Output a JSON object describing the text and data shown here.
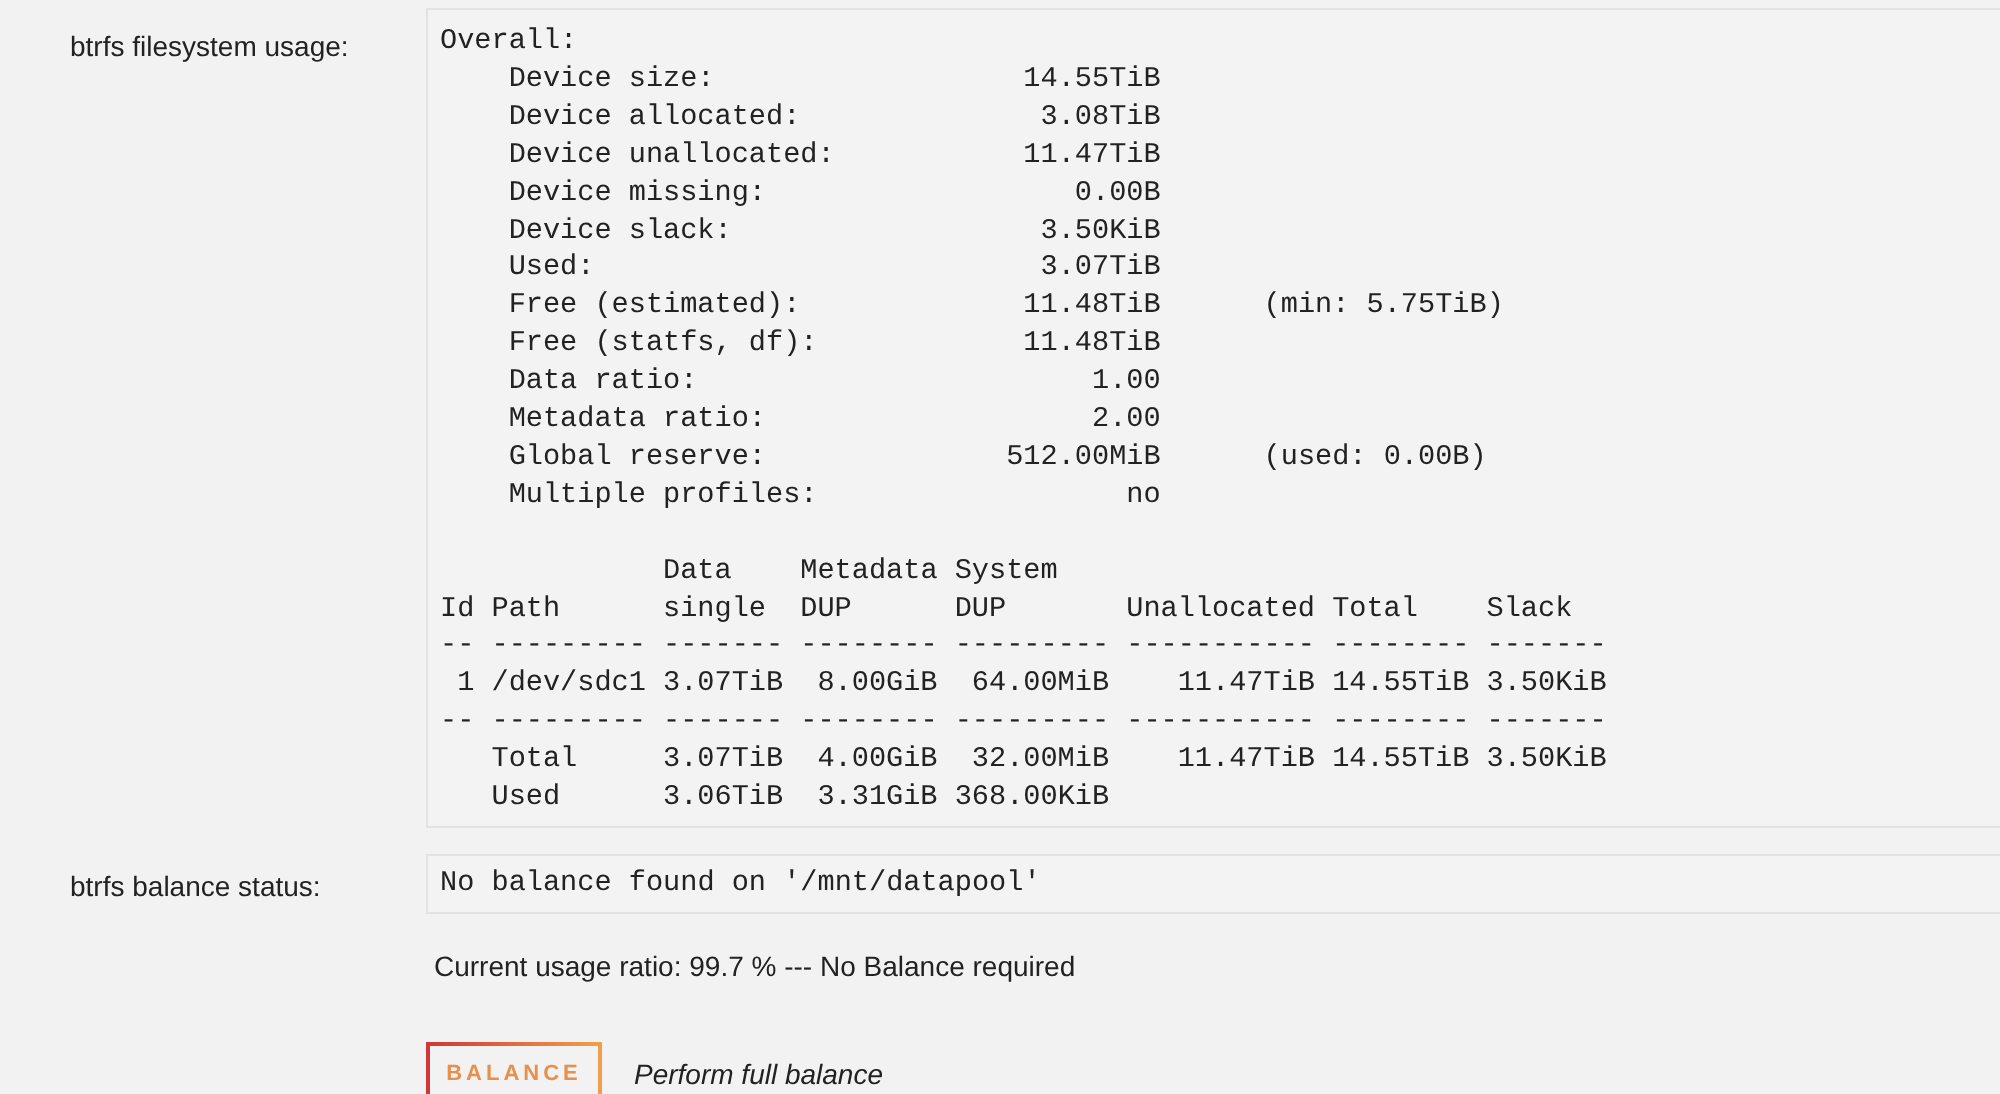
{
  "sections": [
    {
      "label": "btrfs filesystem usage:",
      "overall_title": "Overall:",
      "overall": [
        {
          "label": "Device size:",
          "value": "14.55TiB"
        },
        {
          "label": "Device allocated:",
          "value": "3.08TiB"
        },
        {
          "label": "Device unallocated:",
          "value": "11.47TiB"
        },
        {
          "label": "Device missing:",
          "value": "0.00B"
        },
        {
          "label": "Device slack:",
          "value": "3.50KiB"
        },
        {
          "label": "Used:",
          "value": "3.07TiB"
        },
        {
          "label": "Free (estimated):",
          "value": "11.48TiB",
          "note": "(min: 5.75TiB)"
        },
        {
          "label": "Free (statfs, df):",
          "value": "11.48TiB"
        },
        {
          "label": "Data ratio:",
          "value": "1.00"
        },
        {
          "label": "Metadata ratio:",
          "value": "2.00"
        },
        {
          "label": "Global reserve:",
          "value": "512.00MiB",
          "note": "(used: 0.00B)"
        },
        {
          "label": "Multiple profiles:",
          "value": "no"
        }
      ],
      "table": {
        "header_rows": [
          [
            null,
            null,
            "Data",
            "Metadata",
            "System",
            null,
            null,
            null
          ],
          [
            "Id",
            "Path",
            "single",
            "DUP",
            "DUP",
            "Unallocated",
            "Total",
            "Slack"
          ]
        ],
        "rows": [
          {
            "kind": "rule",
            "cells": [
              "--",
              "---------",
              "-------",
              "--------",
              "---------",
              "-----------",
              "--------",
              "-------"
            ]
          },
          {
            "kind": "data",
            "cells": [
              "1",
              "/dev/sdc1",
              "3.07TiB",
              "8.00GiB",
              "64.00MiB",
              "11.47TiB",
              "14.55TiB",
              "3.50KiB"
            ]
          },
          {
            "kind": "rule",
            "cells": [
              "--",
              "---------",
              "-------",
              "--------",
              "---------",
              "-----------",
              "--------",
              "-------"
            ]
          },
          {
            "kind": "data",
            "cells": [
              null,
              "Total",
              "3.07TiB",
              "4.00GiB",
              "32.00MiB",
              "11.47TiB",
              "14.55TiB",
              "3.50KiB"
            ]
          },
          {
            "kind": "data",
            "cells": [
              null,
              "Used",
              "3.06TiB",
              "3.31GiB",
              "368.00KiB",
              null,
              null,
              null
            ]
          }
        ]
      }
    },
    {
      "label": "btrfs balance status:",
      "output": "No balance found on '/mnt/datapool'"
    }
  ],
  "usage_ratio": "Current usage ratio: 99.7 % --- No Balance required",
  "action": {
    "button": "BALANCE",
    "description": "Perform full balance"
  }
}
